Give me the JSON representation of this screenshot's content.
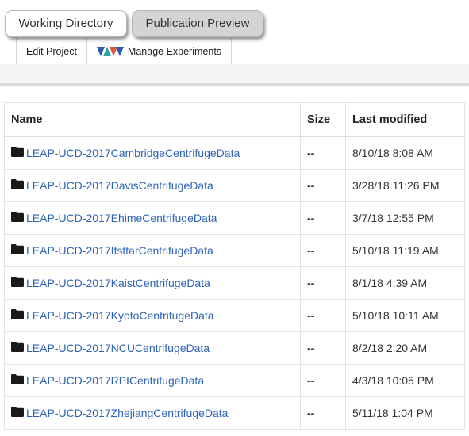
{
  "tabs": [
    {
      "label": "Working Directory",
      "active": true
    },
    {
      "label": "Publication Preview",
      "active": false
    }
  ],
  "toolbar": {
    "edit_project": "Edit Project",
    "manage_experiments": "Manage Experiments"
  },
  "table": {
    "headers": {
      "name": "Name",
      "size": "Size",
      "modified": "Last modified"
    },
    "rows": [
      {
        "name": "LEAP-UCD-2017CambridgeCentrifugeData",
        "size": "--",
        "modified": "8/10/18 8:08 AM"
      },
      {
        "name": "LEAP-UCD-2017DavisCentrifugeData",
        "size": "--",
        "modified": "3/28/18 11:26 PM"
      },
      {
        "name": "LEAP-UCD-2017EhimeCentrifugeData",
        "size": "--",
        "modified": "3/7/18 12:55 PM"
      },
      {
        "name": "LEAP-UCD-2017IfsttarCentrifugeData",
        "size": "--",
        "modified": "5/10/18 11:19 AM"
      },
      {
        "name": "LEAP-UCD-2017KaistCentrifugeData",
        "size": "--",
        "modified": "8/1/18 4:39 AM"
      },
      {
        "name": "LEAP-UCD-2017KyotoCentrifugeData",
        "size": "--",
        "modified": "5/10/18 10:11 AM"
      },
      {
        "name": "LEAP-UCD-2017NCUCentrifugeData",
        "size": "--",
        "modified": "8/2/18 2:20 AM"
      },
      {
        "name": "LEAP-UCD-2017RPICentrifugeData",
        "size": "--",
        "modified": "4/3/18 10:05 PM"
      },
      {
        "name": "LEAP-UCD-2017ZhejiangCentrifugeData",
        "size": "--",
        "modified": "5/11/18 1:04 PM"
      }
    ]
  },
  "icons": {
    "folder": "folder-icon",
    "experiments": "experiments-logo-icon"
  },
  "colors": {
    "link": "#2c63b7",
    "folder": "#1a1a1a",
    "inactive_tab": "#d4d4d4"
  }
}
